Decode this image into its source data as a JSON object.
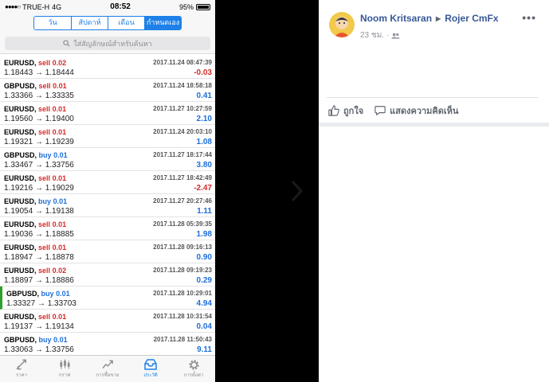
{
  "status_bar": {
    "carrier": "TRUE-H",
    "network": "4G",
    "time": "08:52",
    "battery": "95%"
  },
  "period_tabs": [
    {
      "label": "วัน",
      "active": false
    },
    {
      "label": "สัปดาห์",
      "active": false
    },
    {
      "label": "เดือน",
      "active": false
    },
    {
      "label": "กำหนดเอง",
      "active": true
    }
  ],
  "search": {
    "placeholder": "ใส่สัญลักษณ์สำหรับค้นหา"
  },
  "trades": [
    {
      "symbol": "EURUSD,",
      "direction": "sell",
      "lot": "0.02",
      "date": "2017.11.24 08:47:39",
      "open": "1.18443",
      "close": "1.18444",
      "profit": "-0.03"
    },
    {
      "symbol": "GBPUSD,",
      "direction": "sell",
      "lot": "0.01",
      "date": "2017.11.24 18:58:18",
      "open": "1.33366",
      "close": "1.33335",
      "profit": "0.41"
    },
    {
      "symbol": "EURUSD,",
      "direction": "sell",
      "lot": "0.01",
      "date": "2017.11.27 10:27:59",
      "open": "1.19560",
      "close": "1.19400",
      "profit": "2.10"
    },
    {
      "symbol": "EURUSD,",
      "direction": "sell",
      "lot": "0.01",
      "date": "2017.11.24 20:03:10",
      "open": "1.19321",
      "close": "1.19239",
      "profit": "1.08"
    },
    {
      "symbol": "GBPUSD,",
      "direction": "buy",
      "lot": "0.01",
      "date": "2017.11.27 18:17:44",
      "open": "1.33467",
      "close": "1.33756",
      "profit": "3.80"
    },
    {
      "symbol": "EURUSD,",
      "direction": "sell",
      "lot": "0.01",
      "date": "2017.11.27 18:42:49",
      "open": "1.19216",
      "close": "1.19029",
      "profit": "-2.47"
    },
    {
      "symbol": "EURUSD,",
      "direction": "buy",
      "lot": "0.01",
      "date": "2017.11.27 20:27:46",
      "open": "1.19054",
      "close": "1.19138",
      "profit": "1.11"
    },
    {
      "symbol": "EURUSD,",
      "direction": "sell",
      "lot": "0.01",
      "date": "2017.11.28 05:39:35",
      "open": "1.19036",
      "close": "1.18885",
      "profit": "1.98"
    },
    {
      "symbol": "EURUSD,",
      "direction": "sell",
      "lot": "0.01",
      "date": "2017.11.28 09:16:13",
      "open": "1.18947",
      "close": "1.18878",
      "profit": "0.90"
    },
    {
      "symbol": "EURUSD,",
      "direction": "sell",
      "lot": "0.02",
      "date": "2017.11.28 09:19:23",
      "open": "1.18897",
      "close": "1.18886",
      "profit": "0.29"
    },
    {
      "symbol": "GBPUSD,",
      "direction": "buy",
      "lot": "0.01",
      "date": "2017.11.28 10:29:01",
      "open": "1.33327",
      "close": "1.33703",
      "profit": "4.94",
      "marked": true
    },
    {
      "symbol": "EURUSD,",
      "direction": "sell",
      "lot": "0.01",
      "date": "2017.11.28 10:31:54",
      "open": "1.19137",
      "close": "1.19134",
      "profit": "0.04"
    },
    {
      "symbol": "GBPUSD,",
      "direction": "buy",
      "lot": "0.01",
      "date": "2017.11.28 11:50:43",
      "open": "1.33063",
      "close": "1.33756",
      "profit": "9.11"
    }
  ],
  "tab_bar": [
    {
      "label": "ราคา",
      "icon": "quotes-icon",
      "active": false
    },
    {
      "label": "กราฟ",
      "icon": "chart-icon",
      "active": false
    },
    {
      "label": "การซื้อขาย",
      "icon": "trade-icon",
      "active": false
    },
    {
      "label": "ประวัติ",
      "icon": "history-icon",
      "active": true
    },
    {
      "label": "การตั้งค่า",
      "icon": "settings-icon",
      "active": false
    }
  ],
  "post": {
    "author": "Noom Kritsaran",
    "recipient": "Rojer CmFx",
    "time": "23 ชม.",
    "more": "•••",
    "like_label": "ถูกใจ",
    "comment_label": "แสดงความคิดเห็น"
  },
  "colors": {
    "accent": "#1e80e8",
    "sell": "#d62a2a",
    "buy": "#1e6ed8",
    "fb_name": "#385898"
  }
}
